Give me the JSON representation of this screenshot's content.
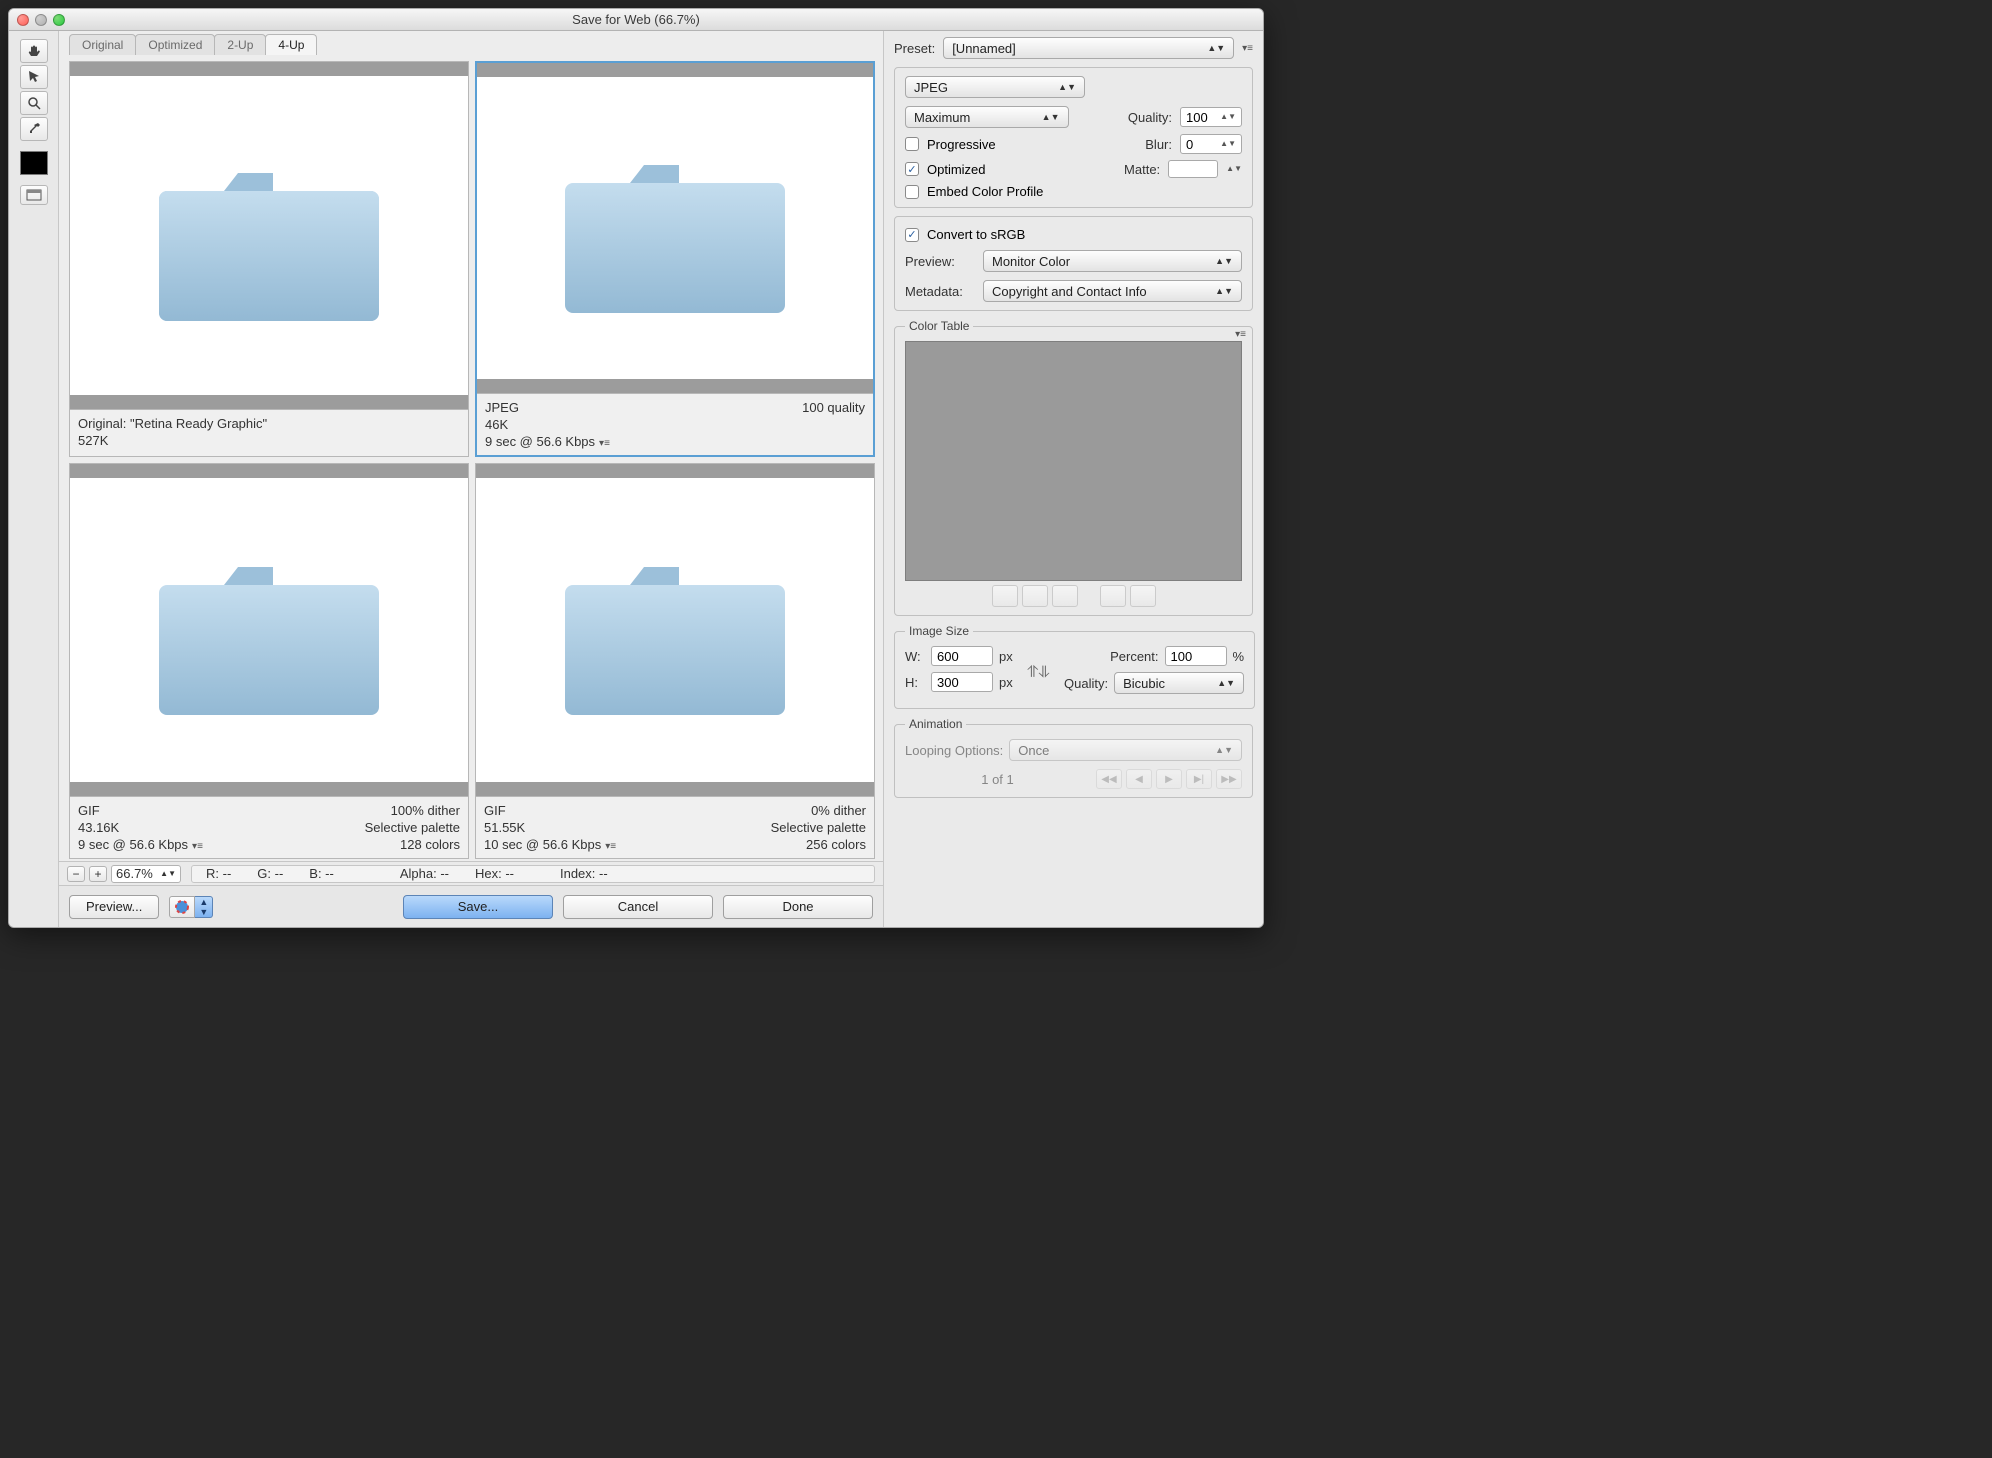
{
  "title": "Save for Web (66.7%)",
  "tabs": [
    "Original",
    "Optimized",
    "2-Up",
    "4-Up"
  ],
  "activeTab": 3,
  "panes": [
    {
      "line1_left": "Original: \"Retina Ready Graphic\"",
      "line1_right": "",
      "line2_left": "527K",
      "line2_right": "",
      "line3_left": "",
      "line3_right": ""
    },
    {
      "line1_left": "JPEG",
      "line1_right": "100 quality",
      "line2_left": "46K",
      "line2_right": "",
      "line3_left": "9 sec @ 56.6 Kbps",
      "line3_right": ""
    },
    {
      "line1_left": "GIF",
      "line1_right": "100% dither",
      "line2_left": "43.16K",
      "line2_right": "Selective palette",
      "line3_left": "9 sec @ 56.6 Kbps",
      "line3_right": "128 colors"
    },
    {
      "line1_left": "GIF",
      "line1_right": "0% dither",
      "line2_left": "51.55K",
      "line2_right": "Selective palette",
      "line3_left": "10 sec @ 56.6 Kbps",
      "line3_right": "256 colors"
    }
  ],
  "selectedPane": 1,
  "status": {
    "zoom": "66.7%",
    "r": "R: --",
    "g": "G: --",
    "b": "B: --",
    "alpha": "Alpha: --",
    "hex": "Hex: --",
    "index": "Index: --"
  },
  "footer": {
    "preview": "Preview...",
    "save": "Save...",
    "cancel": "Cancel",
    "done": "Done"
  },
  "panel": {
    "presetLabel": "Preset:",
    "presetValue": "[Unnamed]",
    "format": "JPEG",
    "qualityPreset": "Maximum",
    "qualityLabel": "Quality:",
    "qualityValue": "100",
    "progressive": "Progressive",
    "blurLabel": "Blur:",
    "blurValue": "0",
    "optimized": "Optimized",
    "matteLabel": "Matte:",
    "embed": "Embed Color Profile",
    "convert": "Convert to sRGB",
    "previewLabel": "Preview:",
    "previewValue": "Monitor Color",
    "metadataLabel": "Metadata:",
    "metadataValue": "Copyright and Contact Info",
    "colorTable": "Color Table",
    "imageSize": "Image Size",
    "wLabel": "W:",
    "wValue": "600",
    "pxLabel": "px",
    "hLabel": "H:",
    "hValue": "300",
    "percentLabel": "Percent:",
    "percentValue": "100",
    "pctUnit": "%",
    "qualityLabel2": "Quality:",
    "resample": "Bicubic",
    "animation": "Animation",
    "loopingLabel": "Looping Options:",
    "loopingValue": "Once",
    "frameInfo": "1 of 1"
  }
}
